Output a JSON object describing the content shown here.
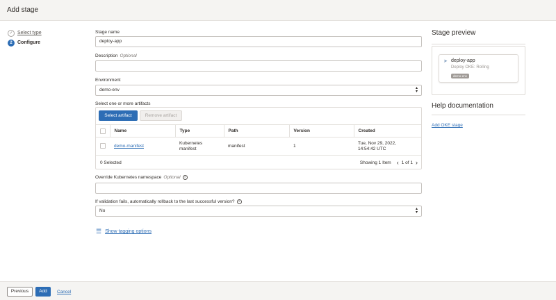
{
  "header": {
    "title": "Add stage"
  },
  "steps": [
    {
      "number": "✓",
      "label": "Select type"
    },
    {
      "number": "2",
      "label": "Configure"
    }
  ],
  "form": {
    "stage_name": {
      "label": "Stage name",
      "value": "deploy-app"
    },
    "description": {
      "label": "Description",
      "optional": "Optional",
      "value": ""
    },
    "environment": {
      "label": "Environment",
      "value": "demo-env"
    },
    "artifacts": {
      "label": "Select one or more artifacts",
      "select_button": "Select artifact",
      "remove_button": "Remove artifact",
      "columns": [
        "Name",
        "Type",
        "Path",
        "Version",
        "Created"
      ],
      "rows": [
        {
          "name": "demo-manifest",
          "type_line1": "Kubernetes",
          "type_line2": "manifest",
          "path": "manifest",
          "version": "1",
          "created_line1": "Tue, Nov 29, 2022,",
          "created_line2": "14:54:42 UTC"
        }
      ],
      "selected_text": "0 Selected",
      "showing_text": "Showing 1 Item",
      "page_text": "1 of 1"
    },
    "namespace": {
      "label": "Override Kubernetes namespace",
      "optional": "Optional",
      "value": ""
    },
    "rollback": {
      "label": "If validation fails, automatically rollback to the last successful version?",
      "value": "No"
    },
    "tagging_link": "Show tagging options"
  },
  "preview": {
    "heading": "Stage preview",
    "card_name": "deploy-app",
    "card_subtitle": "Deploy OKE: Rolling",
    "card_env": "demo-env"
  },
  "help": {
    "heading": "Help documentation",
    "link": "Add OKE stage"
  },
  "footer": {
    "previous": "Previous",
    "add": "Add",
    "cancel": "Cancel"
  },
  "colors": {
    "accent": "#2d6db5",
    "bar_bg": "#f5f4f2",
    "text": "#312d2a"
  }
}
